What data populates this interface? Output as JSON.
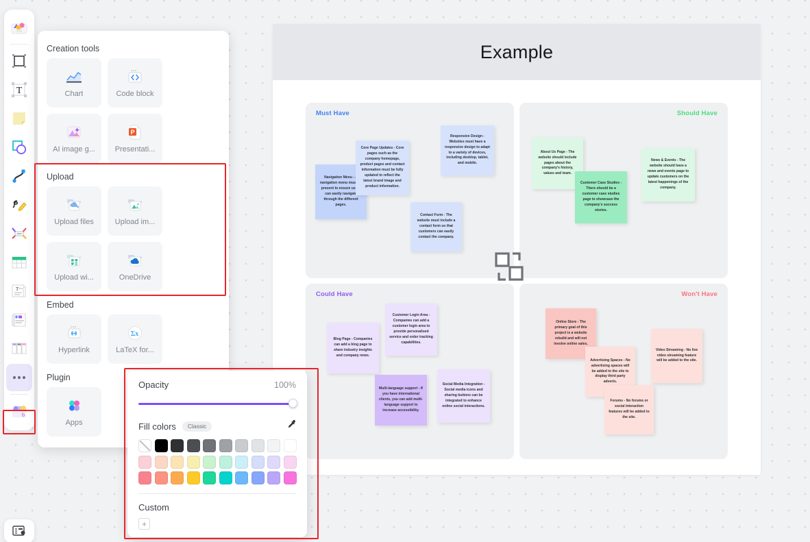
{
  "board": {
    "title": "Example",
    "quadrants": [
      {
        "label": "Must Have",
        "color": "#3b82f6",
        "notes": [
          {
            "text": "Navigation Menu - A navigation menu must be present to ensure users can easily navigate through the different pages.",
            "color": "#c3d4fb"
          },
          {
            "text": "Core Page Updates - Core pages such as the company homepage, product pages and contact information must be fully updated to reflect the latest brand image and product information.",
            "color": "#d6e2fc"
          },
          {
            "text": "Responsive Design - Websites must have a responsive design to adapt to a variety of devices, including desktop, tablet, and mobile.",
            "color": "#d6e2fc"
          },
          {
            "text": "Contact Form - The website must include a contact form so that customers can easily contact the company.",
            "color": "#d6e2fc"
          }
        ]
      },
      {
        "label": "Should Have",
        "color": "#4ade80",
        "notes": [
          {
            "text": "About Us Page - The website should include pages about the company's history, values and team.",
            "color": "#dcf7e5"
          },
          {
            "text": "Customer Case Studies - There should be a customer case studies page to showcase the company's success stories.",
            "color": "#9aebc0"
          },
          {
            "text": "News & Events - The website should have a news and events page to update customers on the latest happenings of the company.",
            "color": "#dcf7e5"
          }
        ]
      },
      {
        "label": "Could Have",
        "color": "#8b5cf6",
        "notes": [
          {
            "text": "Blog Page - Companies can add a blog page to share industry insights and company news.",
            "color": "#ece2fd"
          },
          {
            "text": "Customer Login Area - Companies can add a customer login area to provide personalised service and order tracking capabilities.",
            "color": "#ece2fd"
          },
          {
            "text": "Multi-language support - If you have international clients, you can add multi-language support to increase accessibility.",
            "color": "#d3bcf9"
          },
          {
            "text": "Social Media Integration - Social media icons and sharing buttons can be integrated to enhance online social interactions.",
            "color": "#ece2fd"
          }
        ]
      },
      {
        "label": "Won't Have",
        "color": "#fb7185",
        "notes": [
          {
            "text": "Online Store - The primary goal of this project is a website rebuild and will not involve online sales.",
            "color": "#fac6c1"
          },
          {
            "text": "Advertising Spaces - No advertising spaces will be added to the site to display third party adverts.",
            "color": "#fde0dc"
          },
          {
            "text": "Video Streaming - No live video streaming feature will be added to the site.",
            "color": "#fde0dc"
          },
          {
            "text": "Forums - No forums or social interaction features will be added to the site.",
            "color": "#fde0dc"
          }
        ]
      }
    ]
  },
  "toolbar": {
    "items": [
      {
        "name": "sticker-tool",
        "label": "Stickers"
      },
      {
        "name": "frame-tool",
        "label": "Frame"
      },
      {
        "name": "text-tool",
        "label": "Text"
      },
      {
        "name": "sticky-note-tool",
        "label": "Sticky note"
      },
      {
        "name": "shapes-tool",
        "label": "Shapes"
      },
      {
        "name": "connector-tool",
        "label": "Connector"
      },
      {
        "name": "pen-tool",
        "label": "Pen"
      },
      {
        "name": "mind-map-tool",
        "label": "Mind map"
      },
      {
        "name": "table-tool",
        "label": "Table"
      },
      {
        "name": "document-tool",
        "label": "Document"
      },
      {
        "name": "template-tool",
        "label": "Template"
      },
      {
        "name": "kanban-tool",
        "label": "Kanban"
      },
      {
        "name": "more-tool",
        "label": "More"
      },
      {
        "name": "toolbox-tool",
        "label": "Toolbox"
      }
    ],
    "bottom_item": {
      "name": "presentation-mode",
      "label": "Presentation"
    }
  },
  "insert_panel": {
    "sections": [
      {
        "title": "Creation tools",
        "items": [
          {
            "label": "Chart",
            "icon": "chart-icon"
          },
          {
            "label": "Code block",
            "icon": "code-block-icon"
          },
          {
            "label": "AI image g...",
            "icon": "ai-image-icon"
          },
          {
            "label": "Presentati...",
            "icon": "presentation-icon"
          }
        ]
      },
      {
        "title": "Upload",
        "items": [
          {
            "label": "Upload files",
            "icon": "upload-files-icon"
          },
          {
            "label": "Upload im...",
            "icon": "upload-image-icon"
          },
          {
            "label": "Upload wi...",
            "icon": "upload-widget-icon"
          },
          {
            "label": "OneDrive",
            "icon": "onedrive-icon"
          }
        ]
      },
      {
        "title": "Embed",
        "items": [
          {
            "label": "Hyperlink",
            "icon": "hyperlink-icon"
          },
          {
            "label": "LaTeX for...",
            "icon": "latex-icon"
          }
        ]
      },
      {
        "title": "Plugin",
        "items": [
          {
            "label": "Apps",
            "icon": "apps-icon"
          }
        ]
      }
    ]
  },
  "style_panel": {
    "opacity_label": "Opacity",
    "opacity_value": "100%",
    "opacity_percent": 100,
    "fill_label": "Fill colors",
    "classic_chip": "Classic",
    "custom_label": "Custom",
    "add_custom_label": "+",
    "slider_color": "#7c4dff",
    "swatch_rows": [
      [
        "none",
        "#000000",
        "#2f3032",
        "#4c4e52",
        "#6f7276",
        "#9ea1a5",
        "#c9cbce",
        "#e2e3e5",
        "#f2f3f4",
        "#ffffff"
      ],
      [
        "#fbd0d6",
        "#fbd8c4",
        "#fbe3b4",
        "#f7eeb0",
        "#c9f2cd",
        "#bdf0dd",
        "#cceef9",
        "#d4ddfa",
        "#dfd9fb",
        "#f8d6f1"
      ],
      [
        "#f8838f",
        "#fb9380",
        "#fbab4e",
        "#fccb29",
        "#1ed79a",
        "#06d3cd",
        "#6cb8fb",
        "#88a6fb",
        "#b9a7fa",
        "#f774dd"
      ]
    ]
  }
}
